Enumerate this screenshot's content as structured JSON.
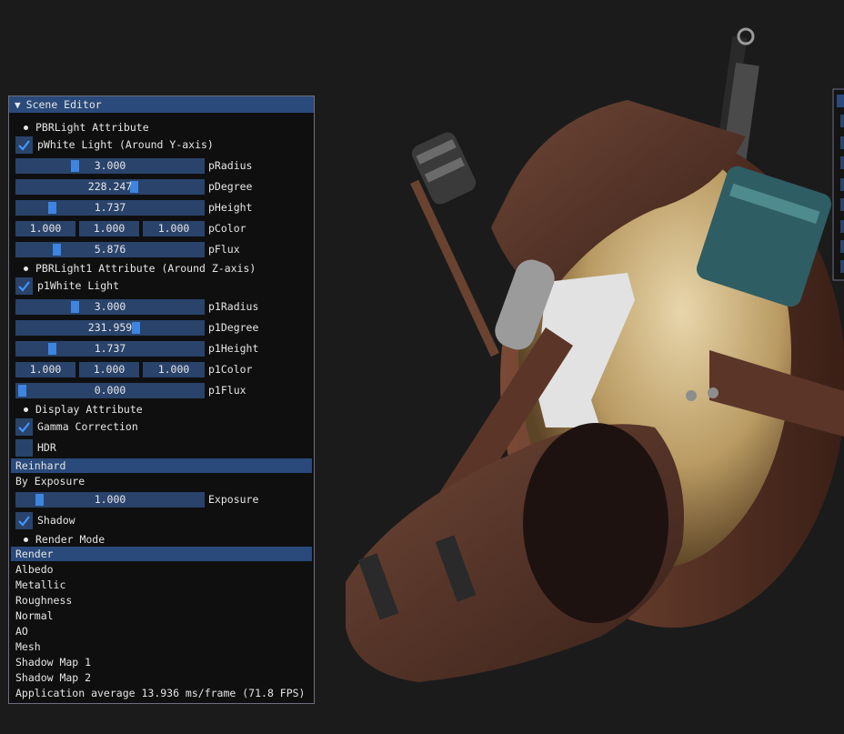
{
  "window": {
    "title": "Scene Editor",
    "collapse_icon": "triangle-down-icon"
  },
  "pbr_light": {
    "section_label": "PBRLight Attribute",
    "enable_label": "pWhite Light (Around Y-axis)",
    "enabled": true,
    "radius": {
      "value": "3.000",
      "label": "pRadius",
      "level": 0.31
    },
    "degree": {
      "value": "228.247",
      "label": "pDegree",
      "level": 0.63
    },
    "height": {
      "value": "1.737",
      "label": "pHeight",
      "level": 0.17
    },
    "color": {
      "r": "1.000",
      "g": "1.000",
      "b": "1.000",
      "label": "pColor"
    },
    "flux": {
      "value": "5.876",
      "label": "pFlux",
      "level": 0.2
    }
  },
  "pbr_light1": {
    "section_label": "PBRLight1 Attribute (Around Z-axis)",
    "enable_label": "p1White Light",
    "enabled": true,
    "radius": {
      "value": "3.000",
      "label": "p1Radius",
      "level": 0.31
    },
    "degree": {
      "value": "231.959",
      "label": "p1Degree",
      "level": 0.64
    },
    "height": {
      "value": "1.737",
      "label": "p1Height",
      "level": 0.17
    },
    "color": {
      "r": "1.000",
      "g": "1.000",
      "b": "1.000",
      "label": "p1Color"
    },
    "flux": {
      "value": "0.000",
      "label": "p1Flux",
      "level": 0.0
    }
  },
  "display": {
    "section_label": "Display Attribute",
    "gamma_label": "Gamma Correction",
    "gamma_enabled": true,
    "hdr_label": "HDR",
    "hdr_enabled": false,
    "tonemap_header": "Reinhard",
    "by_exposure_label": "By Exposure",
    "exposure": {
      "value": "1.000",
      "label": "Exposure",
      "level": 0.11
    },
    "shadow_label": "Shadow",
    "shadow_enabled": true
  },
  "render_mode": {
    "section_label": "Render Mode",
    "header": "Render",
    "items": [
      "Albedo",
      "Metallic",
      "Roughness",
      "Normal",
      "AO",
      "Mesh",
      "Shadow Map 1",
      "Shadow Map 2"
    ]
  },
  "footer": {
    "stats": "Application average 13.936 ms/frame (71.8 FPS)"
  },
  "colors": {
    "window_bg": "#0f0f0f",
    "title_bg": "#294a7a",
    "frame_bg": "#29436b",
    "slider_grab": "#3d85e0",
    "check_mark": "#4296fa"
  }
}
